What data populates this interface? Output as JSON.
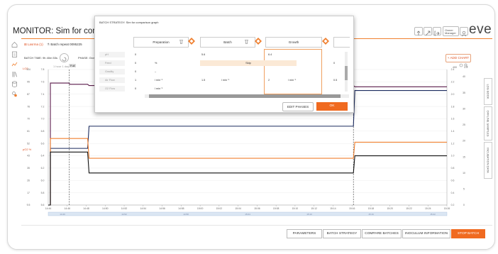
{
  "header": {
    "title": "MONITOR: Sim for comparis",
    "user_name": "Owner",
    "user_role": "Manager",
    "logo": "eve"
  },
  "tabs": [
    {
      "label": "Lasrma (1)"
    },
    {
      "label": "Batch repeat 0095225"
    }
  ],
  "status": {
    "batch_time": "BATCH TIME: 9h 40m 53s",
    "phase": "PHASE: Grow",
    "mini_label": "1 hour 1 day",
    "mini_value": "Full"
  },
  "add_chart": "+ ADD CHART",
  "side_tabs": [
    "LOG BOOK",
    "OFFLINE SAMPLES",
    "INCUBATION DATA"
  ],
  "chart": {
    "left_units": [
      "LO2",
      "pO2 %",
      "OD"
    ],
    "right_units": [
      "No. of cells",
      "Stirrer Speed",
      "Temp"
    ],
    "right_top_labels": [
      "400",
      "3.5"
    ]
  },
  "chart_data": {
    "type": "line",
    "x": [
      "14:44",
      "14:46",
      "14:48",
      "14:50",
      "14:52",
      "14:54",
      "14:56",
      "14:58",
      "15:00",
      "15:02",
      "15:04",
      "15:06",
      "15:08",
      "15:10",
      "15:12",
      "15:14",
      "15:16",
      "15:18",
      "15:20",
      "15:22",
      "15:24",
      "15:26"
    ],
    "left_ticks_outer": [
      "104",
      "95",
      "87",
      "78",
      "70",
      "61",
      "52",
      "43",
      "35",
      "26",
      "17",
      "9.5"
    ],
    "left_ticks_inner": [
      "7.8",
      "7.6",
      "7.4",
      "7.2",
      "7.0",
      "6.8",
      "6.6",
      "6.4",
      "6.2",
      "6.0",
      "5.8",
      "5.6"
    ],
    "right_ticks_inner": [
      "2.4",
      "2.2",
      "2.0",
      "1.8",
      "1.6",
      "1.4",
      "1.2",
      "1.0",
      "0.8",
      "0.6",
      "0.4",
      "0.2"
    ],
    "right_ticks_outer": [
      "40",
      "35",
      "30",
      "25",
      "20",
      "15",
      "10",
      "5",
      "0"
    ],
    "range_labels": [
      "14:46",
      "14:52",
      "14:58",
      "15:04",
      "15:10",
      "15:16",
      "15:22"
    ],
    "series": [
      {
        "color": "#5a1a4a",
        "values": [
          0,
          99,
          98,
          97,
          97,
          97,
          97,
          97,
          97,
          97,
          97,
          97,
          97,
          97,
          97,
          97,
          97,
          96,
          96,
          96,
          96,
          96
        ]
      },
      {
        "color": "#1b2a5e",
        "values": [
          0,
          46,
          46,
          64,
          64,
          64,
          64,
          64,
          64,
          64,
          64,
          64,
          64,
          64,
          64,
          64,
          64,
          93,
          93,
          93,
          93,
          93
        ]
      },
      {
        "color": "#f08030",
        "values": [
          0,
          54,
          54,
          38,
          38,
          38,
          38,
          38,
          38,
          38,
          38,
          38,
          38,
          38,
          38,
          38,
          38,
          51,
          51,
          51,
          51,
          51
        ]
      },
      {
        "color": "#111111",
        "values": [
          0,
          43,
          43,
          26,
          26,
          26,
          26,
          26,
          26,
          26,
          26,
          26,
          26,
          26,
          26,
          26,
          26,
          40,
          40,
          40,
          40,
          40
        ]
      }
    ],
    "ylim": [
      0,
      110
    ]
  },
  "modal": {
    "title": "BATCH STRATEGY: Sim for comparison graph",
    "phases": [
      "Preparation",
      "Batch",
      "Growth"
    ],
    "rows": [
      {
        "label": "pH",
        "c1": "0",
        "c2": "",
        "c3": "5.6",
        "c4": "",
        "c5": "6.4",
        "c6": ""
      },
      {
        "label": "Feed",
        "c1": "0",
        "c2": "%",
        "c3": "",
        "c4": "",
        "c5": "",
        "c6": "0"
      },
      {
        "label": "Gradity",
        "c1": "0",
        "c2": "–",
        "c3": "",
        "c4": "",
        "c5": "",
        "c6": ""
      },
      {
        "label": "Air Flow",
        "c1": "1",
        "c2": "l min⁻¹",
        "c3": "1.5",
        "c4": "l min⁻¹",
        "c5": "2",
        "c6": "l min⁻¹"
      },
      {
        "label": "O2 Flow",
        "c1": "0",
        "c2": "l min⁻¹",
        "c3": "",
        "c4": "",
        "c5": "",
        "c6": ""
      }
    ],
    "skip_label": "Skip",
    "extra_value": "0.5",
    "edit_phases": "EDIT PHASES",
    "ok": "OK"
  },
  "bottom_buttons": [
    "PARAMETERS",
    "BATCH STRATEGY",
    "COMPARE BATCHES",
    "INOCULUM INFORMATION",
    "STOP BATCH"
  ],
  "colors": {
    "accent": "#f08030",
    "stop": "#f06a20"
  }
}
